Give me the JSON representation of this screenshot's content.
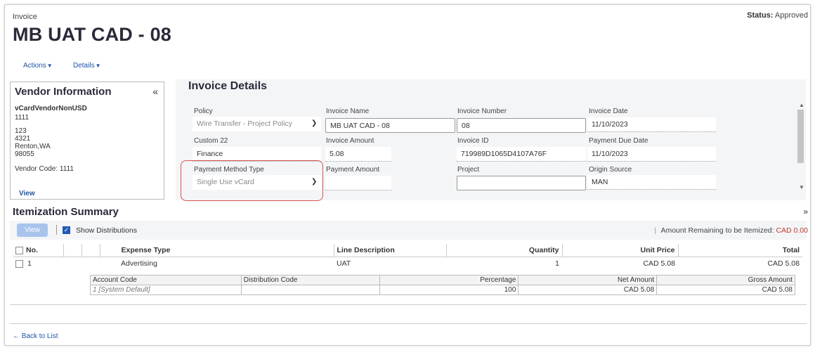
{
  "header": {
    "subtitle": "Invoice",
    "title": "MB UAT CAD - 08",
    "status_label": "Status:",
    "status_value": "Approved"
  },
  "menus": {
    "actions": "Actions",
    "details": "Details"
  },
  "vendor": {
    "heading": "Vendor Information",
    "collapse_icon": "«",
    "name": "vCardVendorNonUSD",
    "id": "1111",
    "address1": "123",
    "address2": "4321",
    "city_state": "Renton,WA",
    "zip": "98055",
    "vendor_code": "Vendor Code: 1111",
    "view_link": "View"
  },
  "details": {
    "heading": "Invoice Details",
    "fields": {
      "policy": {
        "label": "Policy",
        "value": "Wire Transfer - Project Policy"
      },
      "invoice_name": {
        "label": "Invoice Name",
        "value": "MB UAT CAD - 08"
      },
      "invoice_number": {
        "label": "Invoice Number",
        "value": "08"
      },
      "invoice_date": {
        "label": "Invoice Date",
        "value": "11/10/2023"
      },
      "custom22": {
        "label": "Custom 22",
        "value": "Finance"
      },
      "invoice_amount": {
        "label": "Invoice Amount",
        "value": "5.08"
      },
      "invoice_id": {
        "label": "Invoice ID",
        "value": "719989D1065D4107A76F"
      },
      "payment_due_date": {
        "label": "Payment Due Date",
        "value": "11/10/2023"
      },
      "payment_method_type": {
        "label": "Payment Method Type",
        "value": "Single Use vCard"
      },
      "payment_amount": {
        "label": "Payment Amount",
        "value": ""
      },
      "project": {
        "label": "Project",
        "value": ""
      },
      "origin_source": {
        "label": "Origin Source",
        "value": "MAN"
      }
    }
  },
  "itemization": {
    "heading": "Itemization Summary",
    "view_button": "View",
    "show_distributions": "Show Distributions",
    "remaining_label": "Amount Remaining to be Itemized:",
    "remaining_value": "CAD 0.00",
    "columns": {
      "no": "No.",
      "expense_type": "Expense Type",
      "line_description": "Line Description",
      "quantity": "Quantity",
      "unit_price": "Unit Price",
      "total": "Total"
    },
    "rows": [
      {
        "no": "1",
        "expense_type": "Advertising",
        "line_description": "UAT",
        "quantity": "1",
        "unit_price": "CAD 5.08",
        "total": "CAD 5.08"
      }
    ],
    "distribution": {
      "columns": {
        "account_code": "Account Code",
        "distribution_code": "Distribution Code",
        "percentage": "Percentage",
        "net_amount": "Net Amount",
        "gross_amount": "Gross Amount"
      },
      "rows": [
        {
          "account_code": "1 [System Default]",
          "distribution_code": "",
          "percentage": "100",
          "net_amount": "CAD 5.08",
          "gross_amount": "CAD 5.08"
        }
      ]
    }
  },
  "footer": {
    "back_link": "Back to List",
    "back_icon": "←"
  },
  "colors": {
    "link": "#1f55a6",
    "highlight": "#d9534f",
    "remaining": "#c0392b",
    "checkbox": "#1f5bb5"
  }
}
